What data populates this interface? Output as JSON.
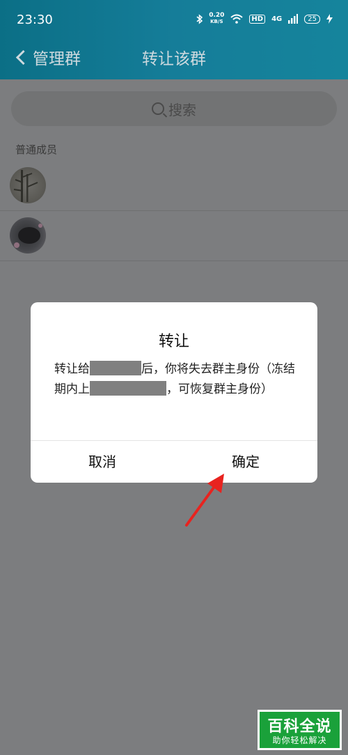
{
  "status_bar": {
    "time": "23:30",
    "net_speed_value": "0.20",
    "net_speed_unit": "KB/S",
    "hd_label": "HD",
    "signal_label": "4G",
    "battery": "25"
  },
  "navbar": {
    "back_label": "管理群",
    "title": "转让该群"
  },
  "search": {
    "placeholder": "搜索"
  },
  "members": {
    "section_label": "普通成员"
  },
  "dialog": {
    "title": "转让",
    "msg_part1": "转让给",
    "msg_part2": "后，你将失去群主身份（冻结期内上",
    "msg_part3": "，可恢复群主身份）",
    "cancel_label": "取消",
    "confirm_label": "确定"
  },
  "watermark": {
    "main": "百科全说",
    "sub": "助你轻松解决"
  },
  "colors": {
    "header_gradient_start": "#0b6f86",
    "header_gradient_end": "#15849c",
    "overlay": "#7c7d7f",
    "arrow": "#e8231f",
    "watermark": "#1aa13a"
  }
}
